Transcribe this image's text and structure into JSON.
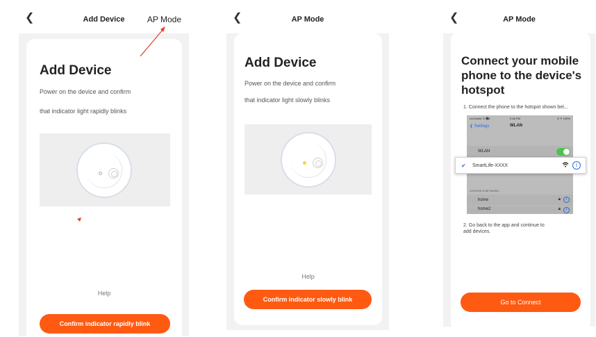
{
  "accent_color": "#ff5a12",
  "panel1": {
    "nav_back_icon": "chevron-left-icon",
    "nav_title": "Add Device",
    "nav_right": "AP Mode",
    "title": "Add Device",
    "desc_line1": "Power on the device and confirm",
    "desc_line2": "that indicator light rapidly blinks",
    "help": "Help",
    "button": "Confirm indicator rapidly blink"
  },
  "panel2": {
    "nav_back_icon": "chevron-left-icon",
    "nav_title": "AP Mode",
    "title": "Add Device",
    "desc_line1": "Power on the device and confirm",
    "desc_line2": "that indicator light slowly blinks",
    "help": "Help",
    "button": "Confirm indicator slowly blink"
  },
  "panel3": {
    "nav_back_icon": "chevron-left-icon",
    "nav_title": "AP Mode",
    "title_line1": "Connect your mobile",
    "title_line2": "phone to the device's",
    "title_line3": "hotspot",
    "step1": "1. Connect the phone to the hotspot shown bel...",
    "step2_line1": "2. Go back to the app and continue to",
    "step2_line2": "add devices.",
    "button": "Go to Connect",
    "screenshot": {
      "status_left": "••••Carrier ⊙ ὏6",
      "status_time": "2:48 PM",
      "status_right": "⊙ ✶ 100%",
      "back_label": "Settings",
      "page_title": "WLAN",
      "wlan_label": "WLAN",
      "section_label": "CHOOSE A NETWORK...",
      "networks": [
        "home",
        "home2"
      ],
      "highlighted_network": "SmartLife-XXXX"
    }
  }
}
